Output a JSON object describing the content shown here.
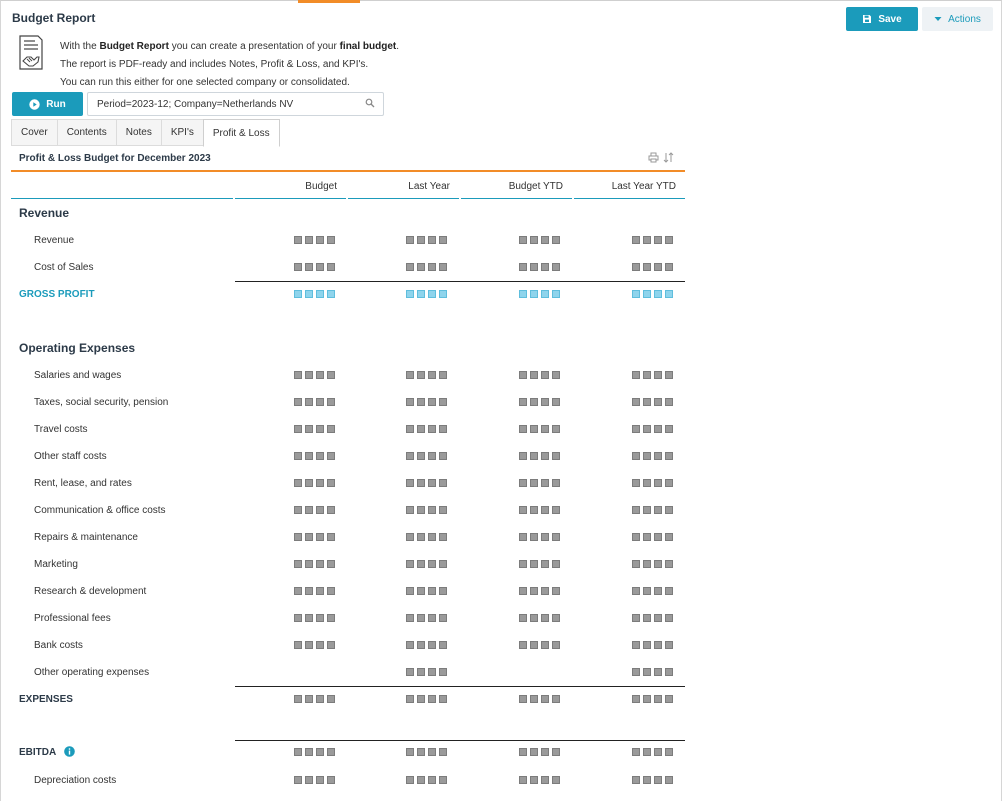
{
  "header": {
    "title": "Budget Report",
    "save_label": "Save",
    "actions_label": "Actions",
    "accent_color": "#1b9bbb",
    "tab_accent_color": "#f28c28"
  },
  "intro": {
    "line1_pre": "With the ",
    "line1_bold1": "Budget Report",
    "line1_mid": " you can create a presentation of your ",
    "line1_bold2": "final budget",
    "line1_post": ".",
    "line2": "The report is PDF-ready and includes Notes, Profit & Loss, and KPI's.",
    "line3": "You can run this either for one selected company or consolidated.",
    "icon": "budget-document-handshake-icon"
  },
  "toolbar": {
    "run_label": "Run",
    "parameters_value": "Period=2023-12; Company=Netherlands NV"
  },
  "tabs": [
    {
      "label": "Cover"
    },
    {
      "label": "Contents"
    },
    {
      "label": "Notes"
    },
    {
      "label": "KPI's"
    },
    {
      "label": "Profit & Loss"
    }
  ],
  "report": {
    "title": "Profit & Loss Budget for December 2023",
    "columns": [
      "Budget",
      "Last Year",
      "Budget YTD",
      "Last Year YTD"
    ],
    "revenue_heading": "Revenue",
    "revenue_rows": [
      {
        "label": "Revenue",
        "values": [
          "masked",
          "masked",
          "masked",
          "masked"
        ]
      },
      {
        "label": "Cost of Sales",
        "values": [
          "masked",
          "masked",
          "masked",
          "masked"
        ]
      }
    ],
    "gross_profit_label": "GROSS PROFIT",
    "opex_heading": "Operating Expenses",
    "opex_rows": [
      {
        "label": "Salaries and wages",
        "values": [
          "masked",
          "masked",
          "masked",
          "masked"
        ]
      },
      {
        "label": "Taxes, social security, pension",
        "values": [
          "masked",
          "masked",
          "masked",
          "masked"
        ]
      },
      {
        "label": "Travel costs",
        "values": [
          "masked",
          "masked",
          "masked",
          "masked"
        ]
      },
      {
        "label": "Other staff costs",
        "values": [
          "masked",
          "masked",
          "masked",
          "masked"
        ]
      },
      {
        "label": "Rent, lease, and rates",
        "values": [
          "masked",
          "masked",
          "masked",
          "masked"
        ]
      },
      {
        "label": "Communication & office costs",
        "values": [
          "masked",
          "masked",
          "masked",
          "masked"
        ]
      },
      {
        "label": "Repairs & maintenance",
        "values": [
          "masked",
          "masked",
          "masked",
          "masked"
        ]
      },
      {
        "label": "Marketing",
        "values": [
          "masked",
          "masked",
          "masked",
          "masked"
        ]
      },
      {
        "label": "Research & development",
        "values": [
          "masked",
          "masked",
          "masked",
          "masked"
        ]
      },
      {
        "label": "Professional fees",
        "values": [
          "masked",
          "masked",
          "masked",
          "masked"
        ]
      },
      {
        "label": "Bank costs",
        "values": [
          "masked",
          "masked",
          "masked",
          "masked"
        ]
      },
      {
        "label": "Other operating expenses",
        "values": [
          "",
          "masked",
          "",
          "masked"
        ]
      }
    ],
    "expenses_label": "EXPENSES",
    "ebitda_label": "EBITDA",
    "depreciation_label": "Depreciation costs"
  }
}
